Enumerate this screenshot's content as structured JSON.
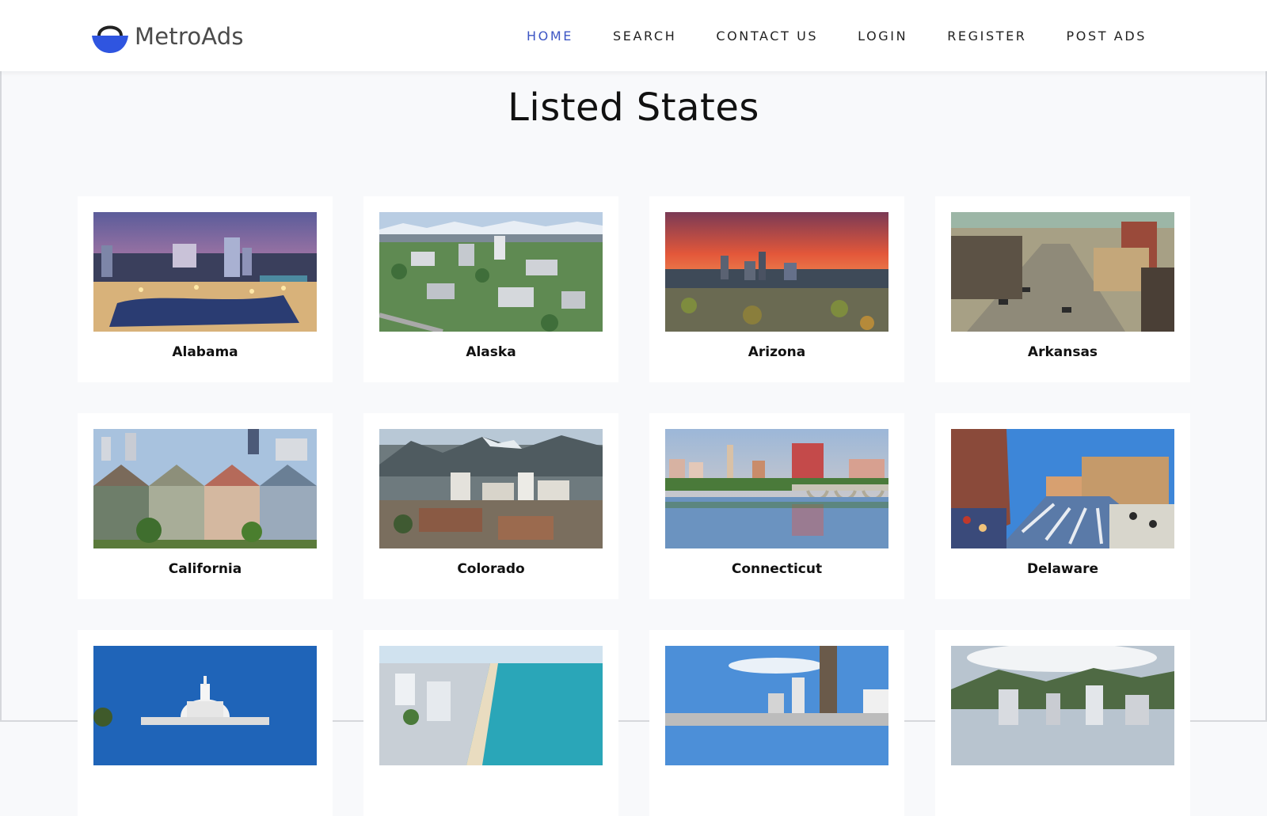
{
  "header": {
    "logo_text": "MetroAds",
    "nav": [
      {
        "label": "HOME",
        "active": true
      },
      {
        "label": "SEARCH",
        "active": false
      },
      {
        "label": "CONTACT US",
        "active": false
      },
      {
        "label": "LOGIN",
        "active": false
      },
      {
        "label": "REGISTER",
        "active": false
      },
      {
        "label": "POST ADS",
        "active": false
      }
    ]
  },
  "main": {
    "title": "Listed States",
    "states": [
      {
        "name": "Alabama"
      },
      {
        "name": "Alaska"
      },
      {
        "name": "Arizona"
      },
      {
        "name": "Arkansas"
      },
      {
        "name": "California"
      },
      {
        "name": "Colorado"
      },
      {
        "name": "Connecticut"
      },
      {
        "name": "Delaware"
      },
      {
        "name": ""
      },
      {
        "name": ""
      },
      {
        "name": ""
      },
      {
        "name": ""
      }
    ]
  },
  "colors": {
    "accent": "#3d56c4",
    "logo_blue": "#2f55e0",
    "background": "#f8f9fb"
  }
}
